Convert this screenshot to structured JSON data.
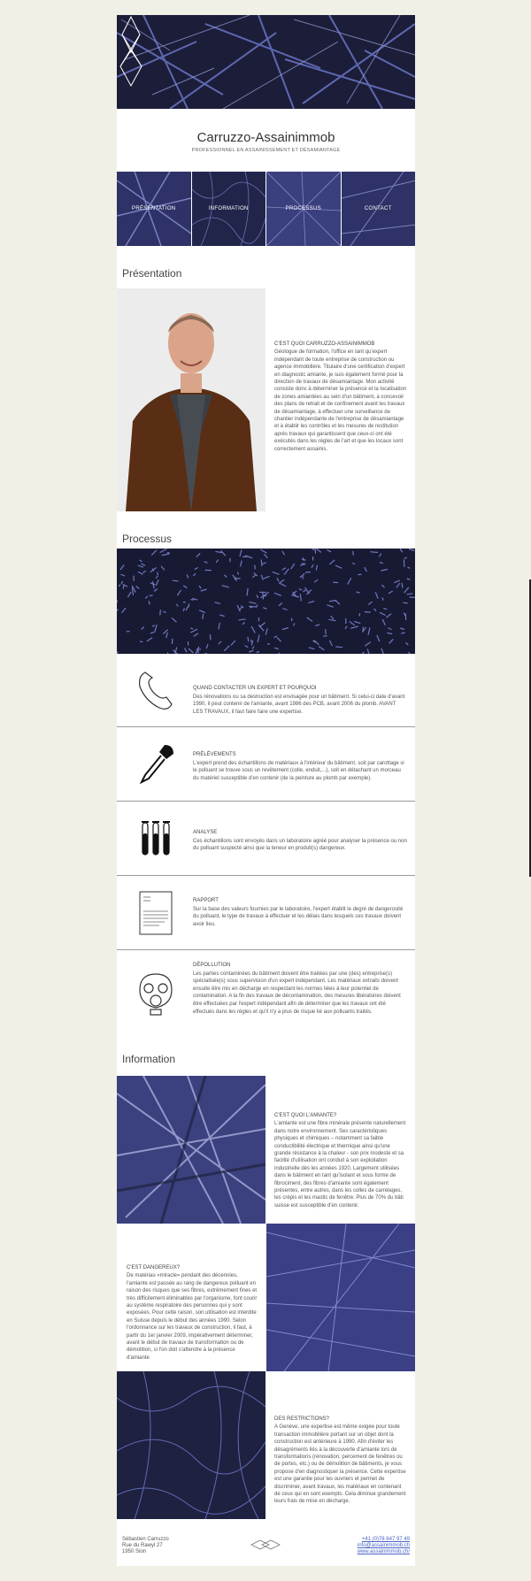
{
  "brand": {
    "title": "Carruzzo-Assainimmob",
    "subtitle": "PROFESSIONNEL EN ASSAINISSEMENT ET DÉSAMIANTAGE"
  },
  "nav": [
    {
      "label": "PRÉSENTATION"
    },
    {
      "label": "INFORMATION"
    },
    {
      "label": "PROCESSUS"
    },
    {
      "label": "CONTACT"
    }
  ],
  "presentation": {
    "title": "Présentation",
    "heading": "C'EST QUOI CARRUZZO-ASSAINIMMOB",
    "body": "Géologue de formation, l'office en tant qu'expert indépendant de toute entreprise de construction ou agence immobilière. Titulaire d'une certification d'expert en diagnostic amiante, je suis également formé pour la direction de travaux de désamiantage. Mon activité consiste donc à déterminer la présence et la localisation de zones amiantées au sein d'un bâtiment, à concevoir des plans de retrait et de confinement avant les travaux de désamiantage, à effectuer une surveillance de chantier indépendante de l'entreprise de désamiantage et à établir les contrôles et les mesures de restitution après travaux qui garantissent que ceux-ci ont été exécutés dans les règles de l'art et que les locaux sont correctement assainis."
  },
  "processus": {
    "title": "Processus",
    "steps": [
      {
        "icon": "phone-icon",
        "heading": "QUAND CONTACTER UN EXPERT ET POURQUOI",
        "body": "Des rénovations ou sa destruction est envisagée pour un bâtiment. Si celui-ci date d'avant 1990, il peut contenir de l'amiante, avant 1986 des PCB, avant 2006 du plomb. AVANT LES TRAVAUX, il faut faire faire une expertise."
      },
      {
        "icon": "pipette-icon",
        "heading": "PRÉLÈVEMENTS",
        "body": "L'expert prend des échantillons de matériaux à l'intérieur du bâtiment, soit par carottage si le polluant se trouve sous un revêtement (colle, enduit,...), soit en détachant un morceau du matériel susceptible d'en contenir (de la peinture au plomb par exemple)."
      },
      {
        "icon": "test-tubes-icon",
        "heading": "ANALYSE",
        "body": "Ces échantillons sont envoyés dans un laboratoire agréé pour analyser la présence ou non du polluant suspecté ainsi que la teneur en produit(s) dangereux."
      },
      {
        "icon": "report-icon",
        "heading": "RAPPORT",
        "body": "Sur la base des valeurs fournies par le laboratoire, l'expert établit le degré de dangerosité du polluant, le type de travaux à effectuer et les délais dans lesquels ces travaux doivent avoir lieu."
      },
      {
        "icon": "gas-mask-icon",
        "heading": "DÉPOLLUTION",
        "body": "Les parties contaminées du bâtiment doivent être traitées par une (des) entreprise(s) spécialisée(s) sous supervision d'un expert indépendant. Les matériaux extraits doivent ensuite être mis en décharge en respectant les normes liées à leur potentiel de contamination. A la fin des travaux de décontamination, des mesures libératoires doivent être effectuées par l'expert indépendant afin de déterminer que les travaux ont été effectués dans les règles et qu'il n'y a plus de risque lié aux polluants traités."
      }
    ]
  },
  "information": {
    "title": "Information",
    "blocks": [
      {
        "heading": "C'EST QUOI L'AMIANTE?",
        "body": "L'amiante est une fibre minérale présente naturellement dans notre environnement. Ses caractéristiques physiques et chimiques – notamment sa faible conductibilité électrique et thermique ainsi qu'une grande résistance à la chaleur - son prix modeste et sa facilité d'utilisation ont conduit à son exploitation industrielle dès les années 1920. Largement utilisées dans le bâtiment en tant qu'isolant et sous forme de fibrociment, des fibres d'amiante sont également présentes, entre autres, dans les colles de carrelages, les crépis et les mastic de fenêtre. Plus de 70% du bâti suisse est susceptible d'en contenir."
      },
      {
        "heading": "C'EST DANGEREUX?",
        "body": "De matériau «miracle» pendant des décennies, l'amiante est passée au rang de dangereux polluant en raison des risques que ses fibres, extrêmement fines et très difficilement éliminables par l'organisme, font courir au système respiratoire des personnes qui y sont exposées. Pour cette raison, son utilisation est interdite en Suisse depuis le début des années 1990. Selon l'ordonnance sur les travaux de construction, il faut, à partir du 1er janvier 2009, impérativement déterminer, avant le début de travaux de transformation ou de démolition, si l'on doit s'attendre à la présence d'amiante"
      },
      {
        "heading": "DES RESTRICTIONS?",
        "body": "A Genève, une expertise est même exigée pour toute transaction immobilière portant sur un objet dont la construction est antérieure à 1990. Afin d'éviter les désagréments liés à la découverte d'amiante lors de transformations (rénovation, percement de fenêtres ou de portes, etc.) ou de démolition de bâtiments, je vous propose d'en diagnostiquer la présence. Cette expertise est une garantie pour les ouvriers et permet de discriminer, avant travaux, les matériaux en contenant de ceux qui en sont exempts. Cela diminue grandement leurs frais de mise en décharge."
      }
    ]
  },
  "footer": {
    "name": "Sébastien Carruzzo",
    "street": "Rue du Rawyl 27",
    "city": "1950 Sion",
    "phone": "+41 (0)78 647 97 49",
    "email": "info@assainimmob.ch",
    "web": "www.assainimmob.ch/"
  },
  "colors": {
    "accent": "#4b5bbf",
    "background": "#f1f0e7",
    "dark_tile": "#1e1f3c"
  }
}
